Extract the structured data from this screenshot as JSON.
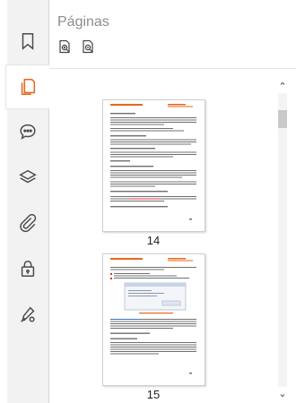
{
  "panel": {
    "title": "Páginas"
  },
  "toolbar_icons": [
    "bookmark-icon",
    "page-thumbnails-icon",
    "comments-icon",
    "layers-icon",
    "attachment-icon",
    "security-lock-icon",
    "signature-pen-icon"
  ],
  "active_item": "page-thumbnails-icon",
  "accent_color": "#e8671c",
  "thumbnails": [
    {
      "page": "14"
    },
    {
      "page": "15"
    }
  ]
}
